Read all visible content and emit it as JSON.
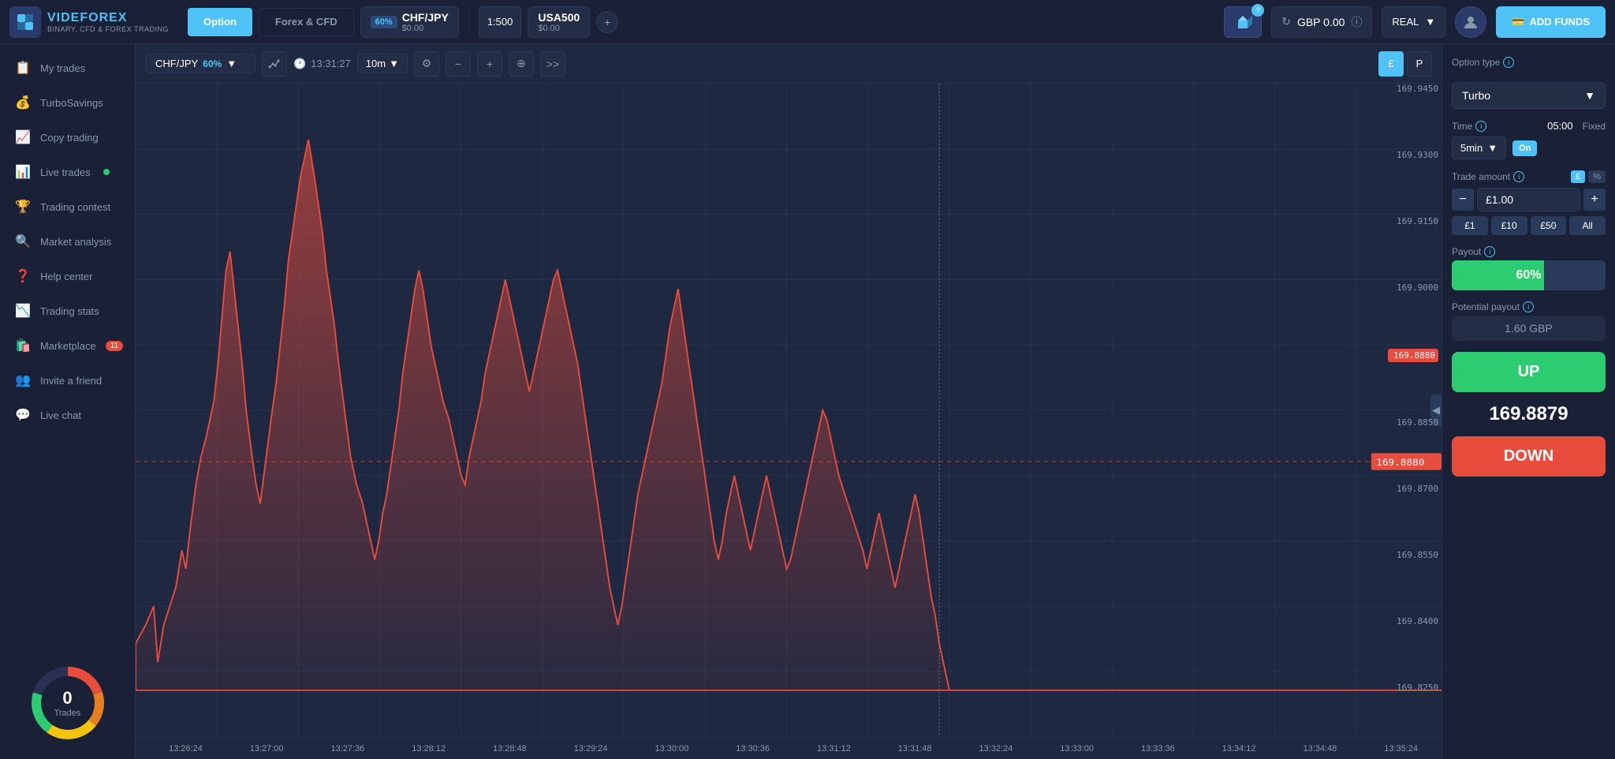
{
  "app": {
    "name": "VIDEFOREX",
    "sub": "BINARY, CFD & FOREX TRADING"
  },
  "topNav": {
    "tab_option": "Option",
    "tab_forex": "Forex & CFD",
    "asset1": {
      "pct": "60%",
      "name": "CHF/JPY",
      "price": "$0.00"
    },
    "asset2": {
      "multiplier": "1:500",
      "name": "USA500",
      "price": "$0.00"
    },
    "add_asset_icon": "+",
    "balance": "GBP 0.00",
    "account_type": "REAL",
    "add_funds_label": "ADD FUNDS"
  },
  "sidebar": {
    "items": [
      {
        "label": "My trades",
        "icon": "📋",
        "badge": null
      },
      {
        "label": "TurboSavings",
        "icon": "💰",
        "badge": null
      },
      {
        "label": "Copy trading",
        "icon": "📈",
        "badge": null
      },
      {
        "label": "Live trades",
        "icon": "📊",
        "dot": true,
        "badge": null
      },
      {
        "label": "Trading contest",
        "icon": "🏆",
        "badge": null
      },
      {
        "label": "Market analysis",
        "icon": "🔍",
        "badge": null
      },
      {
        "label": "Help center",
        "icon": "❓",
        "badge": null
      },
      {
        "label": "Trading stats",
        "icon": "📉",
        "badge": null
      },
      {
        "label": "Marketplace",
        "icon": "🛍️",
        "badge": "11"
      },
      {
        "label": "Invite a friend",
        "icon": "👥",
        "badge": null
      },
      {
        "label": "Live chat",
        "icon": "💬",
        "badge": null
      }
    ],
    "trades_count": "0",
    "trades_label": "Trades"
  },
  "chartToolbar": {
    "pair": "CHF/JPY",
    "pair_pct": "60%",
    "time": "13:31:27",
    "timeframe": "10m",
    "zoom_in": "−",
    "zoom_out": "+",
    "crosshair": "⊕",
    "arrows": ">>",
    "view_left": "£",
    "view_right": "P"
  },
  "chart": {
    "price_current": "169.8880",
    "price_labels": [
      "169.9450",
      "169.9300",
      "169.9150",
      "169.9000",
      "169.8880",
      "169.8850",
      "169.8700",
      "169.8550",
      "169.8400",
      "169.8250"
    ],
    "time_labels": [
      "13:26:24",
      "13:27:00",
      "13:27:36",
      "13:28:12",
      "13:28:48",
      "13:29:24",
      "13:30:00",
      "13:30:36",
      "13:31:12",
      "13:31:48",
      "13:32:24",
      "13:33:00",
      "13:33:36",
      "13:34:12",
      "13:34:48",
      "13:35:24"
    ]
  },
  "rightPanel": {
    "option_type_label": "Option type",
    "option_type_value": "Turbo",
    "time_label": "Time",
    "time_value": "05:00",
    "fixed_label": "Fixed",
    "timeframe_value": "5min",
    "toggle_label": "On",
    "trade_amount_label": "Trade amount",
    "amount_currency": "£",
    "amount_pct": "%",
    "amount_minus": "−",
    "amount_value": "£1.00",
    "amount_plus": "+",
    "quick_btns": [
      "£1",
      "£10",
      "£50",
      "All"
    ],
    "payout_label": "Payout",
    "payout_value": "60%",
    "potential_label": "Potential payout",
    "potential_value": "1.60 GBP",
    "up_label": "UP",
    "current_price": "169.8879",
    "down_label": "DOWN"
  }
}
